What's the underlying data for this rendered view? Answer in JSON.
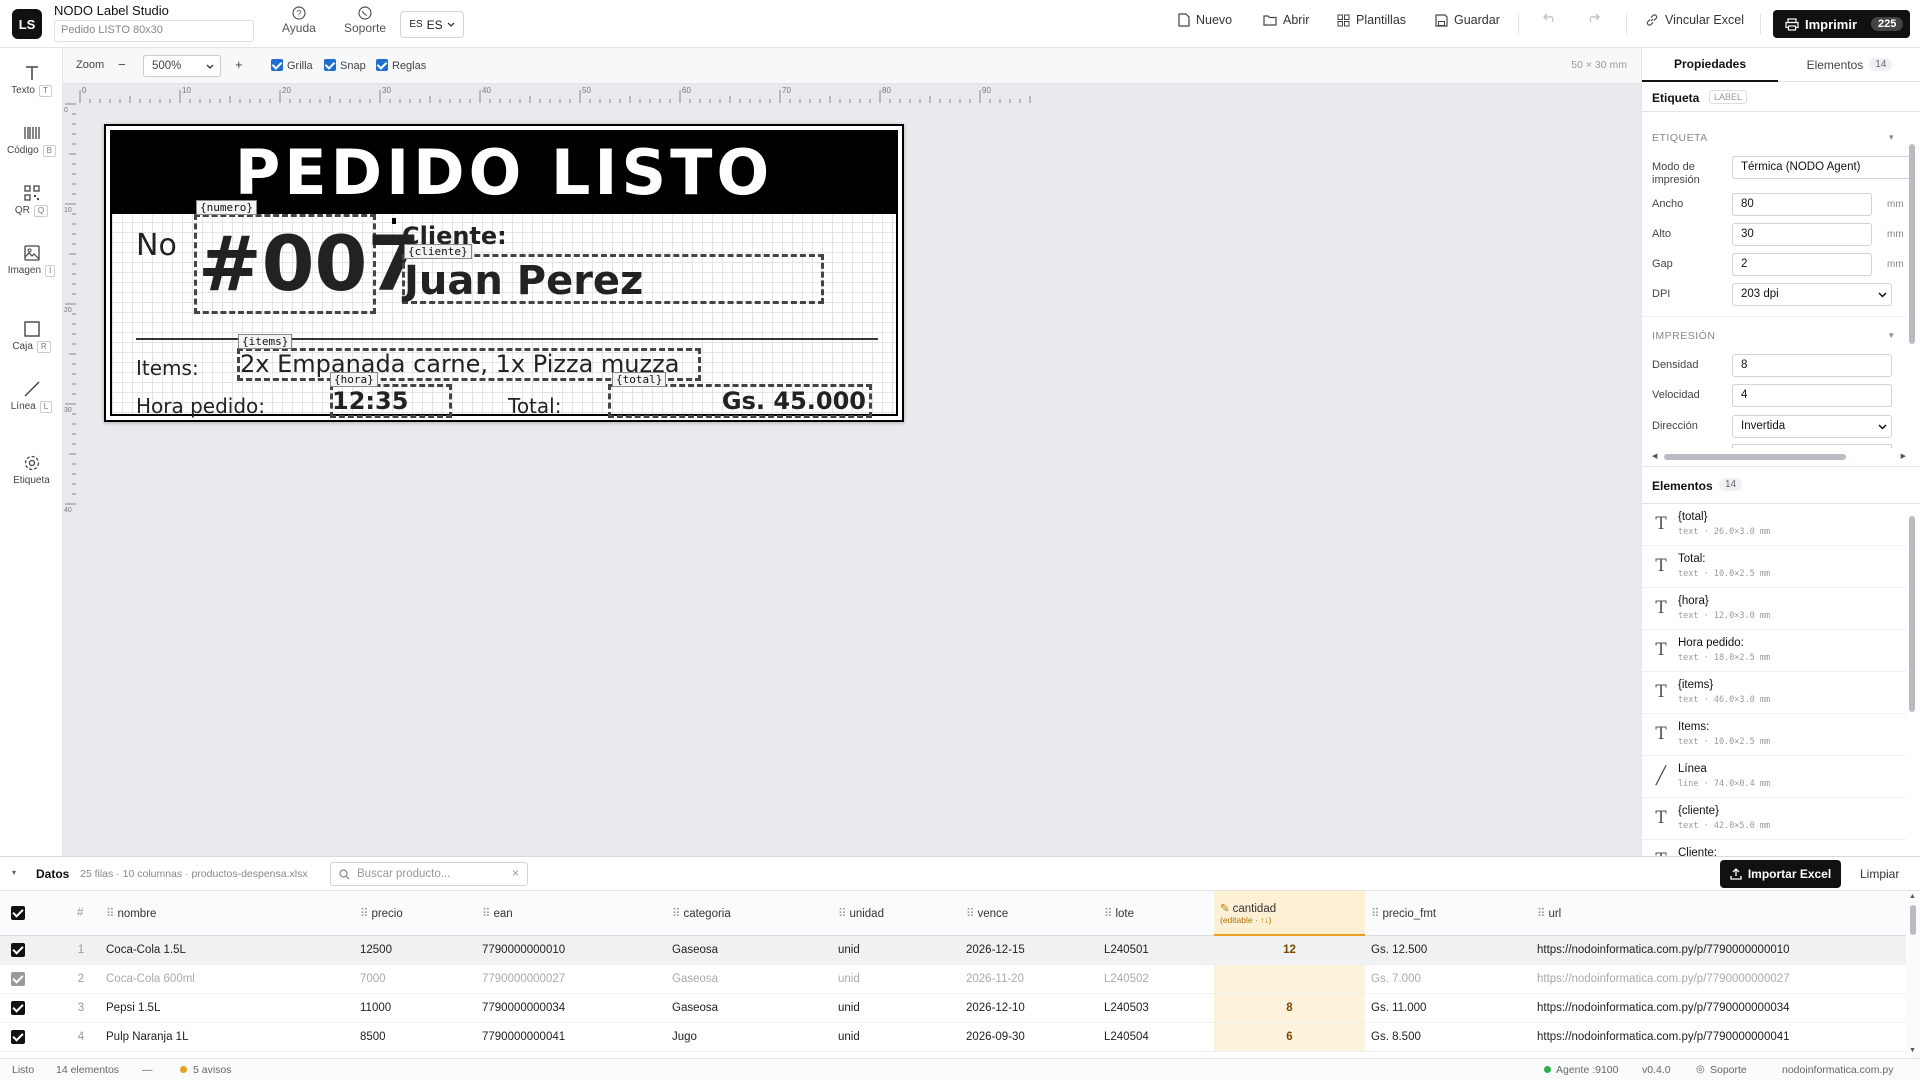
{
  "app": {
    "logo": "LS",
    "title": "NODO Label Studio",
    "doc_name": "Pedido LISTO 80x30"
  },
  "top": {
    "help": "Ayuda",
    "support": "Soporte",
    "lang_code": "ES",
    "lang": "ES",
    "new": "Nuevo",
    "open": "Abrir",
    "templates": "Plantillas",
    "save": "Guardar",
    "link_excel": "Vincular Excel",
    "print": "Imprimir",
    "print_count": "225"
  },
  "tools": [
    {
      "label": "Texto",
      "key": "T"
    },
    {
      "label": "Código",
      "key": "B"
    },
    {
      "label": "QR",
      "key": "Q"
    },
    {
      "label": "Imagen",
      "key": "I"
    },
    {
      "label": "Caja",
      "key": "R"
    },
    {
      "label": "Línea",
      "key": "L"
    },
    {
      "label": "Etiqueta",
      "key": ""
    }
  ],
  "canvas_toolbar": {
    "zoom_label": "Zoom",
    "zoom_minus": "−",
    "zoom_value": "500%",
    "zoom_plus": "+",
    "grid": "Grilla",
    "snap": "Snap",
    "rulers": "Reglas",
    "size": "50 × 30 mm"
  },
  "ruler": {
    "h": [
      "0",
      "10",
      "20",
      "30",
      "40",
      "50",
      "60",
      "70",
      "80",
      "90"
    ],
    "v": [
      "0",
      "10",
      "20",
      "30",
      "40"
    ]
  },
  "label": {
    "header": "PEDIDO LISTO",
    "no_label": "No",
    "numero": "#007",
    "cliente_label": "Cliente:",
    "cliente": "Juan Perez",
    "items_label": "Items:",
    "items": "2x Empanada carne, 1x Pizza muzza",
    "hora_label": "Hora pedido:",
    "hora": "12:35",
    "total_label": "Total:",
    "total": "Gs. 45.000",
    "tags": {
      "numero": "{numero}",
      "cliente": "{cliente}",
      "items": "{items}",
      "hora": "{hora}",
      "total": "{total}"
    }
  },
  "right_panel": {
    "tab_props": "Propiedades",
    "tab_elements": "Elementos",
    "tab_elements_count": "14",
    "sub_title": "Etiqueta",
    "sub_badge": "LABEL",
    "sec_label": "ETIQUETA",
    "mode_label": "Modo de impresión",
    "mode_value": "Térmica (NODO Agent)",
    "width_label": "Ancho",
    "width_value": "80",
    "unit_mm": "mm",
    "height_label": "Alto",
    "height_value": "30",
    "gap_label": "Gap",
    "gap_value": "2",
    "dpi_label": "DPI",
    "dpi_value": "203 dpi",
    "sec_print": "IMPRESIÓN",
    "density_label": "Densidad",
    "density_value": "8",
    "speed_label": "Velocidad",
    "speed_value": "4",
    "direction_label": "Dirección",
    "direction_value": "Invertida",
    "elements_title": "Elementos",
    "elements_count": "14",
    "elements": [
      {
        "name": "{total}",
        "meta": "text · 26.0×3.0 mm",
        "icon": "T"
      },
      {
        "name": "Total:",
        "meta": "text · 10.0×2.5 mm",
        "icon": "T"
      },
      {
        "name": "{hora}",
        "meta": "text · 12.0×3.0 mm",
        "icon": "T"
      },
      {
        "name": "Hora pedido:",
        "meta": "text · 18.0×2.5 mm",
        "icon": "T"
      },
      {
        "name": "{items}",
        "meta": "text · 46.0×3.0 mm",
        "icon": "T"
      },
      {
        "name": "Items:",
        "meta": "text · 10.0×2.5 mm",
        "icon": "T"
      },
      {
        "name": "Línea",
        "meta": "line · 74.0×0.4 mm",
        "icon": "/"
      },
      {
        "name": "{cliente}",
        "meta": "text · 42.0×5.0 mm",
        "icon": "T"
      },
      {
        "name": "Cliente:",
        "meta": "",
        "icon": "T"
      }
    ]
  },
  "data_panel": {
    "title": "Datos",
    "info": "25 filas · 10 columnas · productos-despensa.xlsx",
    "search_placeholder": "Buscar producto...",
    "import": "Importar Excel",
    "clear": "Limpiar",
    "columns": [
      "#",
      "nombre",
      "precio",
      "ean",
      "categoria",
      "unidad",
      "vence",
      "lote",
      "cantidad",
      "precio_fmt",
      "url"
    ],
    "qty_sub": "(editable · ↑↓)",
    "rows": [
      {
        "n": "1",
        "nombre": "Coca-Cola 1.5L",
        "precio": "12500",
        "ean": "7790000000010",
        "categoria": "Gaseosa",
        "unidad": "unid",
        "vence": "2026-12-15",
        "lote": "L240501",
        "cantidad": "12",
        "precio_fmt": "Gs. 12.500",
        "url": "https://nodoinformatica.com.py/p/7790000000010"
      },
      {
        "n": "2",
        "nombre": "Coca-Cola 600ml",
        "precio": "7000",
        "ean": "7790000000027",
        "categoria": "Gaseosa",
        "unidad": "unid",
        "vence": "2026-11-20",
        "lote": "L240502",
        "cantidad": "",
        "precio_fmt": "Gs. 7.000",
        "url": "https://nodoinformatica.com.py/p/7790000000027"
      },
      {
        "n": "3",
        "nombre": "Pepsi 1.5L",
        "precio": "11000",
        "ean": "7790000000034",
        "categoria": "Gaseosa",
        "unidad": "unid",
        "vence": "2026-12-10",
        "lote": "L240503",
        "cantidad": "8",
        "precio_fmt": "Gs. 11.000",
        "url": "https://nodoinformatica.com.py/p/7790000000034"
      },
      {
        "n": "4",
        "nombre": "Pulp Naranja 1L",
        "precio": "8500",
        "ean": "7790000000041",
        "categoria": "Jugo",
        "unidad": "unid",
        "vence": "2026-09-30",
        "lote": "L240504",
        "cantidad": "6",
        "precio_fmt": "Gs. 8.500",
        "url": "https://nodoinformatica.com.py/p/7790000000041"
      }
    ]
  },
  "status": {
    "state": "Listo",
    "elements": "14 elementos",
    "dash": "—",
    "warnings": "5 avisos",
    "agent": "Agente :9100",
    "version": "v0.4.0",
    "support": "Soporte",
    "site": "nodoinformatica.com.py"
  },
  "colors": {
    "accent": "#1f6fd1",
    "dark": "#111111",
    "qty_bg": "#fdf3dc",
    "warn": "#e8a020",
    "ok": "#2bb24c"
  }
}
